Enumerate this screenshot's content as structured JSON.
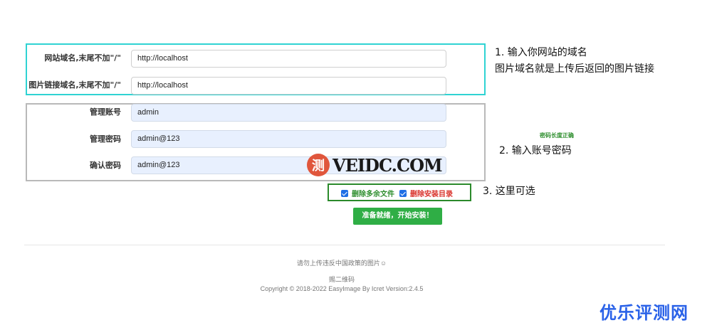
{
  "form": {
    "site_domain": {
      "label": "网站域名,末尾不加\"/\"",
      "value": "http://localhost"
    },
    "image_domain": {
      "label": "图片链接域名,末尾不加\"/\"",
      "value": "http://localhost"
    },
    "admin_user": {
      "label": "管理账号",
      "value": "admin"
    },
    "admin_pass": {
      "label": "管理密码",
      "value": "admin@123"
    },
    "confirm_pass": {
      "label": "确认密码",
      "value": "admin@123"
    },
    "password_hint": "密码长度正确",
    "delete_extra_files": "删除多余文件",
    "delete_install_dir": "删除安装目录",
    "submit": "准备就绪，开始安装！"
  },
  "notes": {
    "note1_line1": "1.  输入你网站的域名",
    "note1_line2": "图片域名就是上传后返回的图片链接",
    "note2": "2. 输入账号密码",
    "note3": "3. 这里可选"
  },
  "footer": {
    "line1": "请勿上传违反中国政策的图片☺",
    "line2": "赐二维码",
    "line3": "Copyright © 2018-2022 EasyImage By Icret Version:2.4.5"
  },
  "watermark": {
    "logo_char": "测",
    "text": "VEIDC.COM"
  },
  "brand": "优乐评测网",
  "colors": {
    "cyan_box": "#2fd3d3",
    "gray_box": "#b9b9b9",
    "green_box": "#2b8a2b",
    "button": "#2fae45",
    "hint": "#2f8f2f",
    "danger": "#d9322b",
    "brand": "#2a62e8"
  }
}
